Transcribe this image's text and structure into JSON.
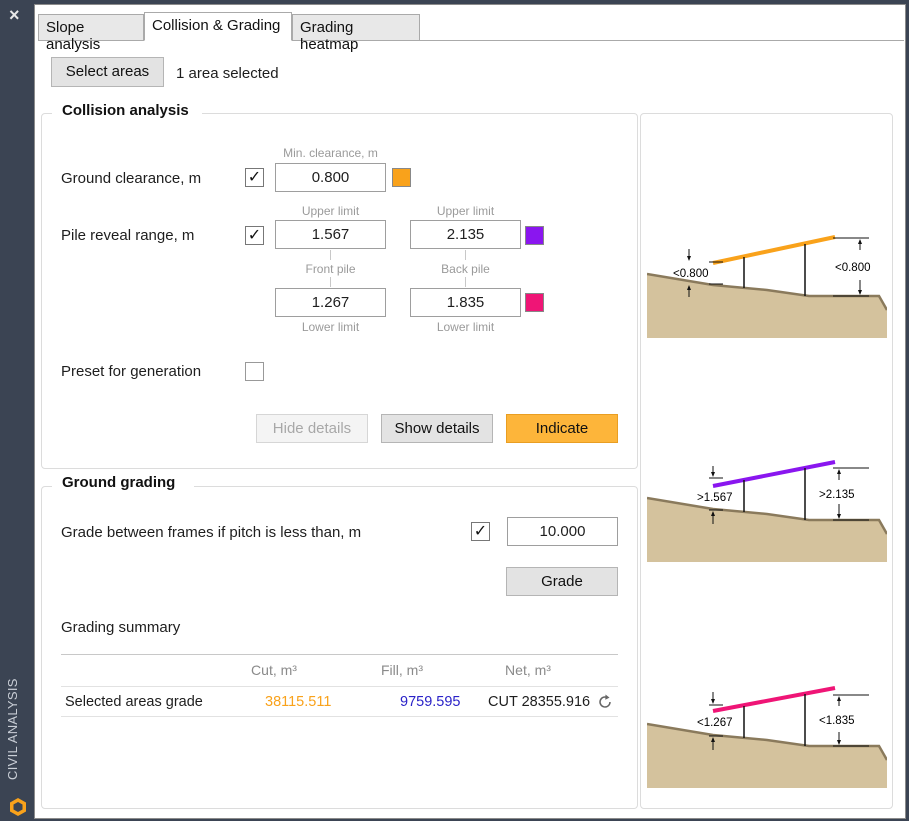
{
  "sidebar": {
    "close_glyph": "×",
    "label": "CIVIL ANALYSIS",
    "close_icon": "close-icon",
    "logo_icon": "app-logo-icon"
  },
  "tabs": [
    "Slope analysis",
    "Collision & Grading",
    "Grading heatmap"
  ],
  "active_tab": "Collision & Grading",
  "select_areas": {
    "button": "Select areas",
    "status": "1 area selected"
  },
  "collision": {
    "title": "Collision analysis",
    "ground_clearance": {
      "label": "Ground clearance, m",
      "checked": true,
      "caption": "Min. clearance, m",
      "value": "0.800",
      "color": "#f9a21b"
    },
    "pile_reveal": {
      "label": "Pile reveal range, m",
      "checked": true,
      "upper_caption_front": "Upper limit",
      "upper_caption_back": "Upper limit",
      "front_caption": "Front pile",
      "back_caption": "Back pile",
      "lower_caption_front": "Lower limit",
      "lower_caption_back": "Lower limit",
      "upper_front": "1.567",
      "upper_back": "2.135",
      "lower_front": "1.267",
      "lower_back": "1.835",
      "upper_color": "#8a16ef",
      "lower_color": "#ef1576"
    },
    "preset": {
      "label": "Preset for generation",
      "checked": false
    },
    "buttons": {
      "hide": "Hide details",
      "show": "Show details",
      "indicate": "Indicate"
    }
  },
  "grading": {
    "title": "Ground grading",
    "pitch_label": "Grade between frames if pitch is less than, m",
    "pitch_checked": true,
    "pitch_value": "10.000",
    "grade_button": "Grade",
    "summary_title": "Grading summary",
    "columns": [
      "Cut, m³",
      "Fill, m³",
      "Net, m³"
    ],
    "row": {
      "name": "Selected areas grade",
      "cut": "38115.511",
      "fill": "9759.595",
      "net": "CUT 28355.916"
    },
    "cut_color": "#f9a21b",
    "fill_color": "#2a22c8",
    "refresh_icon": "refresh-icon"
  },
  "illustrations": [
    {
      "left_label": "<0.800",
      "right_label": "<0.800",
      "color": "#f9a21b"
    },
    {
      "left_label": ">1.567",
      "right_label": ">2.135",
      "color": "#8a16ef"
    },
    {
      "left_label": "<1.267",
      "right_label": "<1.835",
      "color": "#ef1576"
    }
  ]
}
